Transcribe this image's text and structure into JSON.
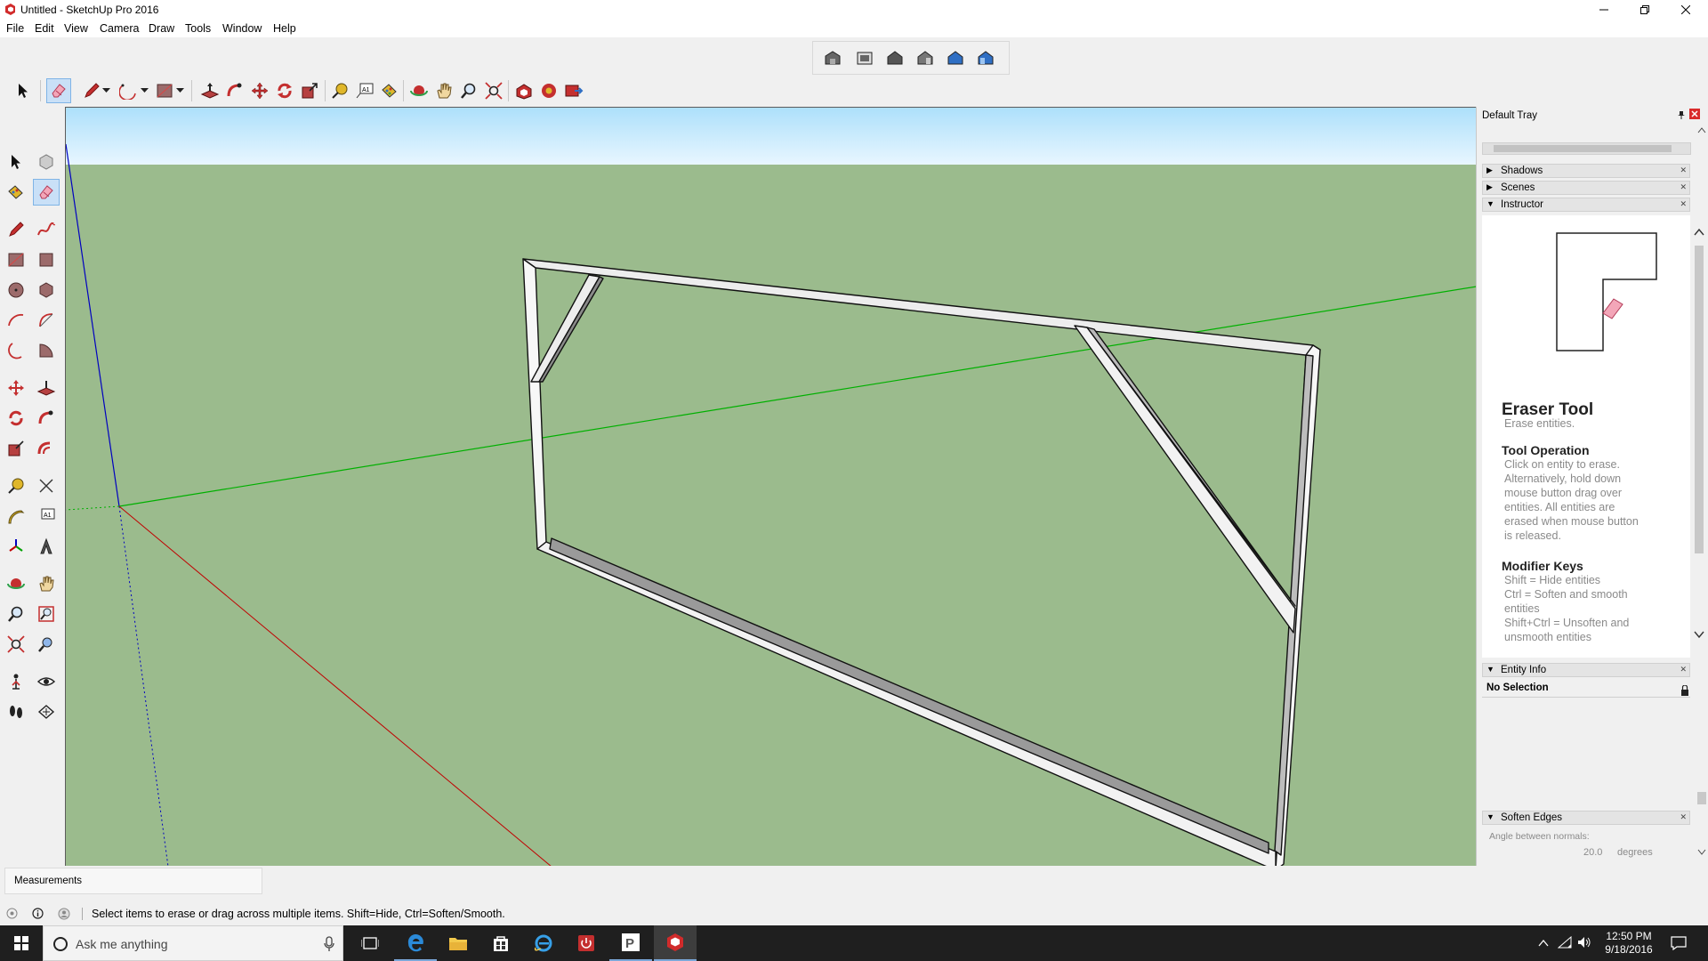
{
  "window": {
    "title": "Untitled - SketchUp Pro 2016"
  },
  "menu": {
    "items": [
      "File",
      "Edit",
      "View",
      "Camera",
      "Draw",
      "Tools",
      "Window",
      "Help"
    ]
  },
  "tray": {
    "title": "Default Tray",
    "panels": {
      "shadows": "Shadows",
      "scenes": "Scenes",
      "instructor": "Instructor",
      "entity_info": "Entity Info",
      "soften_edges": "Soften Edges"
    },
    "instructor": {
      "tool_name": "Eraser Tool",
      "tool_desc": "Erase entities.",
      "operation_heading": "Tool Operation",
      "operation_lines": [
        "Click on entity to erase.",
        "Alternatively, hold down",
        "mouse button drag over",
        "entities. All entities are",
        "erased when mouse button",
        "is released."
      ],
      "modifier_heading": "Modifier Keys",
      "modifier_lines": [
        "Shift = Hide entities",
        "Ctrl = Soften and smooth",
        "entities",
        "Shift+Ctrl = Unsoften and",
        "unsmooth entities"
      ]
    },
    "entity_info": {
      "selection": "No Selection"
    },
    "soften_edges": {
      "label": "Angle between normals:",
      "value": "20.0",
      "unit": "degrees"
    }
  },
  "status": {
    "measurements_label": "Measurements",
    "hint": "Select items to erase or drag across multiple items. Shift=Hide, Ctrl=Soften/Smooth."
  },
  "taskbar": {
    "search_placeholder": "Ask me anything",
    "time": "12:50 PM",
    "date": "9/18/2016"
  },
  "colors": {
    "sky": "#ade0fb",
    "ground": "#9bbb8d",
    "axis_red": "#c00000",
    "axis_green": "#00b000",
    "axis_blue": "#0000c0",
    "selection_highlight": "#c9e0f7"
  }
}
